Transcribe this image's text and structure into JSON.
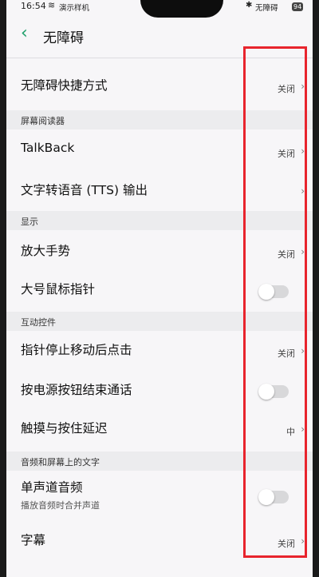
{
  "status_bar": {
    "time": "16:54",
    "carrier": "演示样机",
    "service": "无障碍",
    "battery": "94"
  },
  "header": {
    "title": "无障碍"
  },
  "rows": {
    "shortcut": {
      "label": "无障碍快捷方式",
      "value": "关闭"
    },
    "talkback": {
      "label": "TalkBack",
      "value": "关闭"
    },
    "tts": {
      "label": "文字转语音 (TTS) 输出"
    },
    "magnify": {
      "label": "放大手势",
      "value": "关闭"
    },
    "large_pointer": {
      "label": "大号鼠标指针",
      "toggle_on": false
    },
    "dwell_click": {
      "label": "指针停止移动后点击",
      "value": "关闭"
    },
    "power_end_call": {
      "label": "按电源按钮结束通话",
      "toggle_on": false
    },
    "touch_delay": {
      "label": "触摸与按住延迟",
      "value": "中"
    },
    "mono_audio": {
      "label": "单声道音频",
      "sub": "播放音频时合并声道",
      "toggle_on": false
    },
    "captions": {
      "label": "字幕",
      "value": "关闭"
    }
  },
  "sections": {
    "screen_reader": "屏幕阅读器",
    "display": "显示",
    "interaction": "互动控件",
    "audio_text": "音频和屏幕上的文字"
  },
  "colors": {
    "accent": "#1e9f6a",
    "annotation": "#e8242d",
    "background": "#f7f6f8"
  },
  "icons": {
    "back": "chevron-left-icon",
    "bluetooth": "bluetooth-icon",
    "wifi": "wifi-icon",
    "chevron": "chevron-right-icon"
  }
}
